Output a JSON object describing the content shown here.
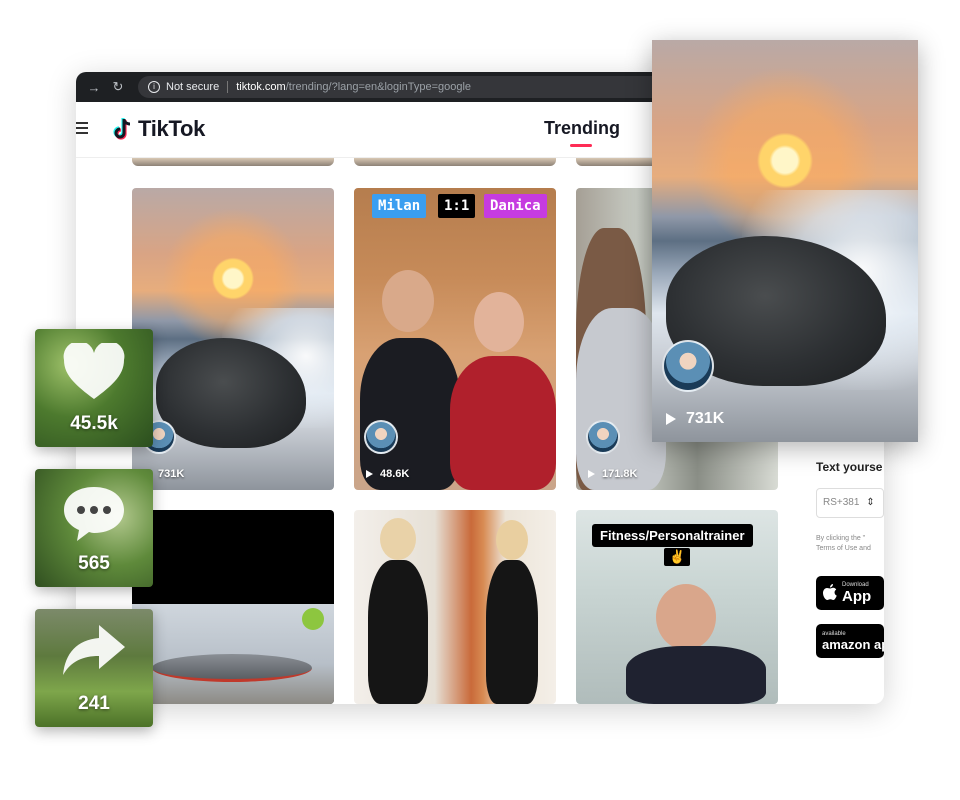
{
  "browser": {
    "security_label": "Not secure",
    "url_host": "tiktok.com",
    "url_path": "/trending/?lang=en&loginType=google"
  },
  "header": {
    "logo_text": "TikTok",
    "tab_trending": "Trending"
  },
  "videos": [
    {
      "views": "731K"
    },
    {
      "views": "48.6K",
      "tags": [
        "Milan",
        "1:1",
        "Danica"
      ]
    },
    {
      "views": "171.8K"
    },
    {
      "views": ""
    },
    {
      "views": ""
    },
    {
      "views": "",
      "caption": "Fitness/Personaltrainer",
      "emoji": "✌"
    }
  ],
  "side_panel": {
    "text_prompt": "Text yourse",
    "country_code": "RS+381",
    "terms_line1": "By clicking the \"",
    "terms_line2": "Terms of Use and",
    "app_store_small": "Download",
    "app_store_big": "App",
    "amazon_small": "available",
    "amazon_big": "amazon ap"
  },
  "popout": {
    "views": "731K"
  },
  "stats": {
    "likes": "45.5k",
    "comments": "565",
    "shares": "241"
  },
  "colors": {
    "tiktok_red": "#fe2c55",
    "tag_milan": "#3a9ef0",
    "tag_ratio": "#000000",
    "tag_danica": "#c63be0"
  }
}
